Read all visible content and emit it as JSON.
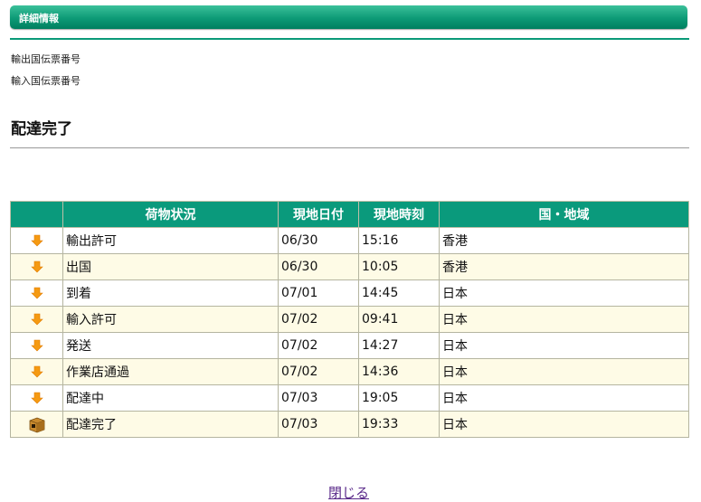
{
  "header": {
    "title": "詳細情報",
    "accent_color": "#0a9a7c"
  },
  "labels": {
    "export_invoice": "輸出国伝票番号",
    "import_invoice": "輸入国伝票番号"
  },
  "status": {
    "title": "配達完了"
  },
  "table": {
    "headers": [
      "",
      "荷物状況",
      "現地日付",
      "現地時刻",
      "国・地域"
    ],
    "rows": [
      {
        "icon": "down-arrow-icon",
        "status": "輸出許可",
        "date": "06/30",
        "time": "15:16",
        "region": "香港"
      },
      {
        "icon": "down-arrow-icon",
        "status": "出国",
        "date": "06/30",
        "time": "10:05",
        "region": "香港"
      },
      {
        "icon": "down-arrow-icon",
        "status": "到着",
        "date": "07/01",
        "time": "14:45",
        "region": "日本"
      },
      {
        "icon": "down-arrow-icon",
        "status": "輸入許可",
        "date": "07/02",
        "time": "09:41",
        "region": "日本"
      },
      {
        "icon": "down-arrow-icon",
        "status": "発送",
        "date": "07/02",
        "time": "14:27",
        "region": "日本"
      },
      {
        "icon": "down-arrow-icon",
        "status": "作業店通過",
        "date": "07/02",
        "time": "14:36",
        "region": "日本"
      },
      {
        "icon": "down-arrow-icon",
        "status": "配達中",
        "date": "07/03",
        "time": "19:05",
        "region": "日本"
      },
      {
        "icon": "package-icon",
        "status": "配達完了",
        "date": "07/03",
        "time": "19:33",
        "region": "日本"
      }
    ]
  },
  "footer": {
    "close_label": "閉じる"
  }
}
